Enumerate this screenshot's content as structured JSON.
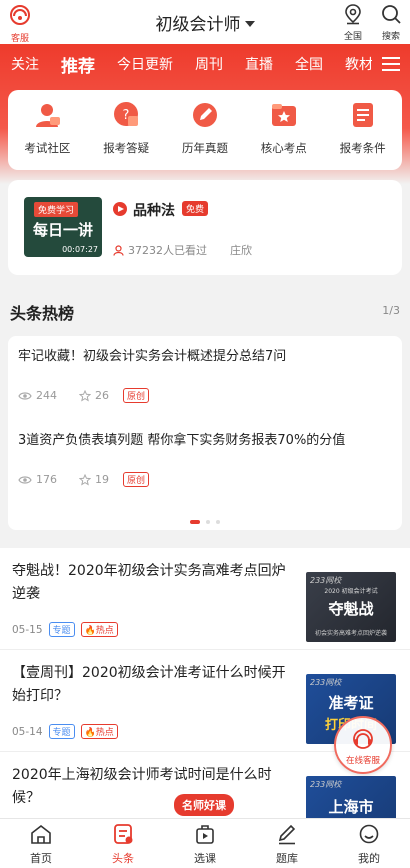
{
  "topbar": {
    "service_label": "客服",
    "title": "初级会计师",
    "country_label": "全国",
    "search_label": "搜索"
  },
  "tabs": [
    "关注",
    "推荐",
    "今日更新",
    "周刊",
    "直播",
    "全国",
    "教材"
  ],
  "active_tab": "推荐",
  "categories": [
    {
      "label": "考试社区",
      "icon": "community-icon"
    },
    {
      "label": "报考答疑",
      "icon": "qa-icon"
    },
    {
      "label": "历年真题",
      "icon": "pen-icon"
    },
    {
      "label": "核心考点",
      "icon": "star-folder-icon"
    },
    {
      "label": "报考条件",
      "icon": "list-icon"
    }
  ],
  "course": {
    "thumb_tag": "免费学习",
    "thumb_title": "每日一讲",
    "duration": "00:07:27",
    "title": "品种法",
    "free_badge": "免费",
    "viewers": "37232人已看过",
    "teacher": "庄欣"
  },
  "hot": {
    "title": "头条热榜",
    "page": "1/3",
    "items": [
      {
        "title": "牢记收藏！初级会计实务会计概述提分总结7问",
        "views": "244",
        "stars": "26",
        "badge": "原创"
      },
      {
        "title": "3道资产负债表填列题 帮你拿下实务财务报表70%的分值",
        "views": "176",
        "stars": "19",
        "badge": "原创"
      }
    ]
  },
  "articles": [
    {
      "title": "夺魁战！2020年初级会计实务高难考点回炉逆袭",
      "date": "05-15",
      "tag": "专题",
      "hot": "热点",
      "img_brand": "233网校",
      "img_sub": "2020 初级会计考试",
      "img_big": "夺魁战",
      "img_foot": "初会实务高难考点回炉逆袭"
    },
    {
      "title": "【壹周刊】2020初级会计准考证什么时候开始打印？",
      "date": "05-14",
      "tag": "专题",
      "hot": "热点",
      "img_brand": "233网校",
      "img_big": "准考证",
      "img_big2": "打印时间"
    },
    {
      "title": "2020年上海初级会计师考试时间是什么时候？",
      "img_brand": "233网校",
      "img_big": "上海市"
    }
  ],
  "float_service": "在线客服",
  "badge": "名师好课",
  "nav": [
    "首页",
    "头条",
    "选课",
    "题库",
    "我的"
  ],
  "active_nav": "头条",
  "colors": {
    "accent": "#e63b2e",
    "blue_tag": "#4a8df0"
  }
}
